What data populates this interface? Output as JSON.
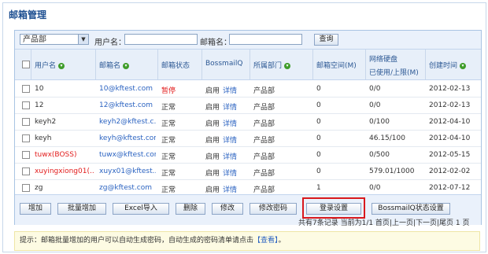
{
  "page": {
    "title": "邮箱管理"
  },
  "search": {
    "department_value": "产品部",
    "username_label": "用户名：",
    "username_value": "",
    "mailbox_label": "邮箱名：",
    "mailbox_value": "",
    "query_button": "查询"
  },
  "table": {
    "columns": [
      "用户名",
      "邮箱名",
      "邮箱状态",
      "BossmailQ",
      "所属部门",
      "邮箱空间(M)",
      "网络硬盘",
      "已使用/上限(M)",
      "创建时间"
    ],
    "rows": [
      {
        "user": "10",
        "mail": "10@kftest.com",
        "status": "暂停",
        "status_color": "red",
        "bq": "启用",
        "detail": "详情",
        "dept": "产品部",
        "space": "0",
        "disk": "0/0",
        "created": "2012-02-13",
        "user_red": false
      },
      {
        "user": "12",
        "mail": "12@kftest.com",
        "status": "正常",
        "status_color": "normal",
        "bq": "启用",
        "detail": "详情",
        "dept": "产品部",
        "space": "0",
        "disk": "0/0",
        "created": "2012-02-13",
        "user_red": false
      },
      {
        "user": "keyh2",
        "mail": "keyh2@kftest.c...",
        "status": "正常",
        "status_color": "normal",
        "bq": "启用",
        "detail": "详情",
        "dept": "产品部",
        "space": "0",
        "disk": "0/100",
        "created": "2012-04-10",
        "user_red": false
      },
      {
        "user": "keyh",
        "mail": "keyh@kftest.com",
        "status": "正常",
        "status_color": "normal",
        "bq": "启用",
        "detail": "详情",
        "dept": "产品部",
        "space": "0",
        "disk": "46.15/100",
        "created": "2012-04-10",
        "user_red": false
      },
      {
        "user": "tuwx(BOSS)",
        "mail": "tuwx@kftest.com",
        "status": "正常",
        "status_color": "normal",
        "bq": "启用",
        "detail": "详情",
        "dept": "产品部",
        "space": "0",
        "disk": "0/500",
        "created": "2012-05-15",
        "user_red": true
      },
      {
        "user": "xuyingxiong01(...",
        "mail": "xuyx01@kftest...",
        "status": "正常",
        "status_color": "normal",
        "bq": "启用",
        "detail": "详情",
        "dept": "产品部",
        "space": "0",
        "disk": "579.01/1000",
        "created": "2012-02-02",
        "user_red": true
      },
      {
        "user": "zg",
        "mail": "zg@kftest.com",
        "status": "正常",
        "status_color": "normal",
        "bq": "启用",
        "detail": "详情",
        "dept": "产品部",
        "space": "1",
        "disk": "0/0",
        "created": "2012-07-12",
        "user_red": false
      }
    ]
  },
  "actions": {
    "add": "增加",
    "batch_add": "批量增加",
    "excel_import": "Excel导入",
    "delete": "删除",
    "modify": "修改",
    "change_password": "修改密码",
    "login_settings": "登录设置",
    "bossmailq_status": "BossmailQ状态设置"
  },
  "pager": {
    "text": "共有7条记录 当前为1/1 首页|上一页|下一页|尾页 1 页"
  },
  "tip": {
    "prefix": "提示：邮箱批量增加的用户可以自动生成密码，自动生成的密码清单请点击",
    "link": "【查看】",
    "suffix": "。"
  },
  "colors": {
    "accent": "#1d4f91",
    "link": "#2b63c1",
    "danger": "#e21c1c",
    "highlight": "#d9191d"
  }
}
